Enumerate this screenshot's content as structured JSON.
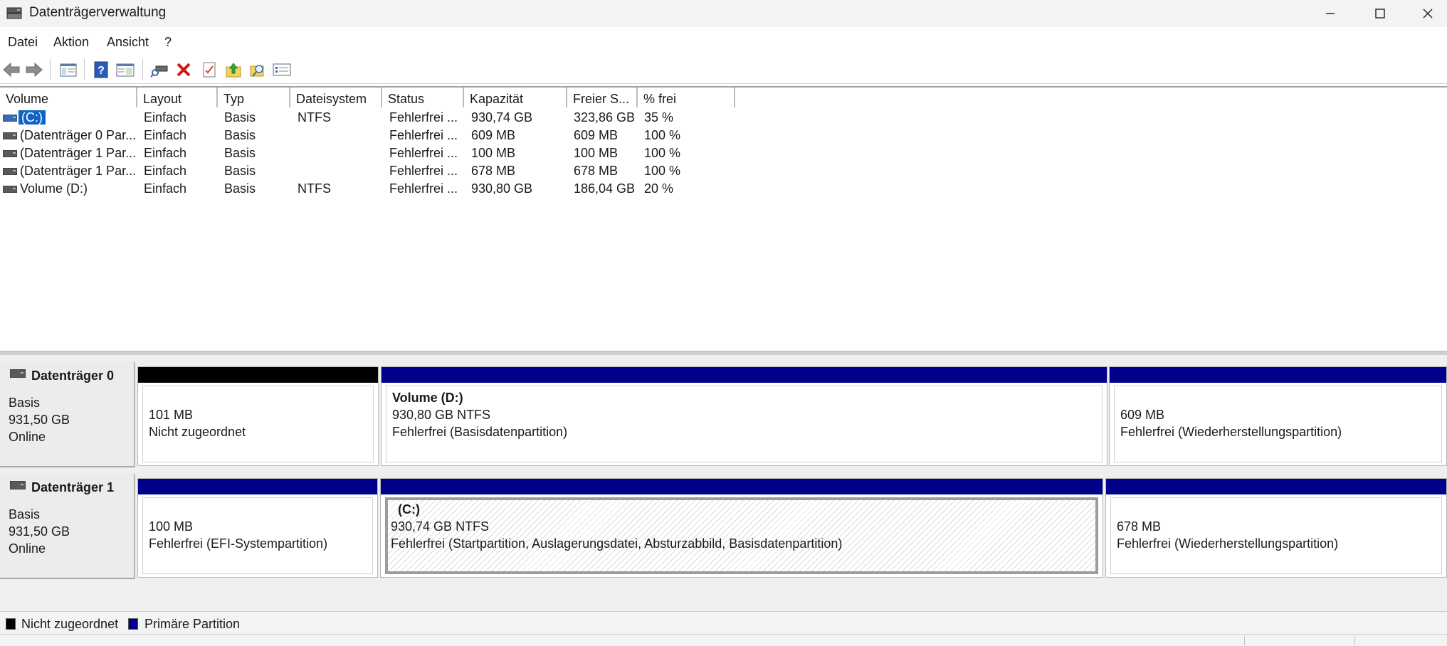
{
  "window": {
    "title": "Datenträgerverwaltung",
    "minimize_icon": "minimize-icon",
    "maximize_icon": "maximize-icon",
    "close_icon": "close-icon"
  },
  "menu": {
    "items": [
      "Datei",
      "Aktion",
      "Ansicht",
      "?"
    ]
  },
  "toolbar": {
    "icons": [
      "back-icon",
      "forward-icon",
      "console-tree-icon",
      "help-icon",
      "properties-view-icon",
      "connect-disk-icon",
      "delete-icon",
      "checklist-icon",
      "export-icon",
      "search-folder-icon",
      "settings-list-icon"
    ]
  },
  "volume_list": {
    "columns": [
      "Volume",
      "Layout",
      "Typ",
      "Dateisystem",
      "Status",
      "Kapazität",
      "Freier S...",
      "% frei"
    ],
    "rows": [
      {
        "volume": "(C:)",
        "layout": "Einfach",
        "typ": "Basis",
        "fs": "NTFS",
        "status": "Fehlerfrei ...",
        "capacity": "930,74 GB",
        "free": "323,86 GB",
        "pct": "35 %",
        "selected": true
      },
      {
        "volume": "(Datenträger 0 Par...",
        "layout": "Einfach",
        "typ": "Basis",
        "fs": "",
        "status": "Fehlerfrei ...",
        "capacity": "609 MB",
        "free": "609 MB",
        "pct": "100 %",
        "selected": false
      },
      {
        "volume": "(Datenträger 1 Par...",
        "layout": "Einfach",
        "typ": "Basis",
        "fs": "",
        "status": "Fehlerfrei ...",
        "capacity": "100 MB",
        "free": "100 MB",
        "pct": "100 %",
        "selected": false
      },
      {
        "volume": "(Datenträger 1 Par...",
        "layout": "Einfach",
        "typ": "Basis",
        "fs": "",
        "status": "Fehlerfrei ...",
        "capacity": "678 MB",
        "free": "678 MB",
        "pct": "100 %",
        "selected": false
      },
      {
        "volume": "Volume (D:)",
        "layout": "Einfach",
        "typ": "Basis",
        "fs": "NTFS",
        "status": "Fehlerfrei ...",
        "capacity": "930,80 GB",
        "free": "186,04 GB",
        "pct": "20 %",
        "selected": false
      }
    ]
  },
  "disks": [
    {
      "name": "Datenträger 0",
      "type": "Basis",
      "size": "931,50 GB",
      "state": "Online",
      "partitions": [
        {
          "bar": "black",
          "title": "",
          "line1": "101 MB",
          "line2": "Nicht zugeordnet"
        },
        {
          "bar": "blue",
          "title": "Volume  (D:)",
          "line1": "930,80 GB NTFS",
          "line2": "Fehlerfrei (Basisdatenpartition)"
        },
        {
          "bar": "blue",
          "title": "",
          "line1": "609 MB",
          "line2": "Fehlerfrei (Wiederherstellungspartition)"
        }
      ]
    },
    {
      "name": "Datenträger 1",
      "type": "Basis",
      "size": "931,50 GB",
      "state": "Online",
      "partitions": [
        {
          "bar": "blue",
          "title": "",
          "line1": "100 MB",
          "line2": "Fehlerfrei (EFI-Systempartition)"
        },
        {
          "bar": "blue",
          "title": "(C:)",
          "line1": "930,74 GB NTFS",
          "line2": "Fehlerfrei (Startpartition, Auslagerungsdatei, Absturzabbild, Basisdatenpartition)",
          "selected": true
        },
        {
          "bar": "blue",
          "title": "",
          "line1": "678 MB",
          "line2": "Fehlerfrei (Wiederherstellungspartition)"
        }
      ]
    }
  ],
  "legend": {
    "items": [
      {
        "label": "Nicht zugeordnet",
        "color": "#000000"
      },
      {
        "label": "Primäre Partition",
        "color": "#00008b"
      }
    ]
  }
}
